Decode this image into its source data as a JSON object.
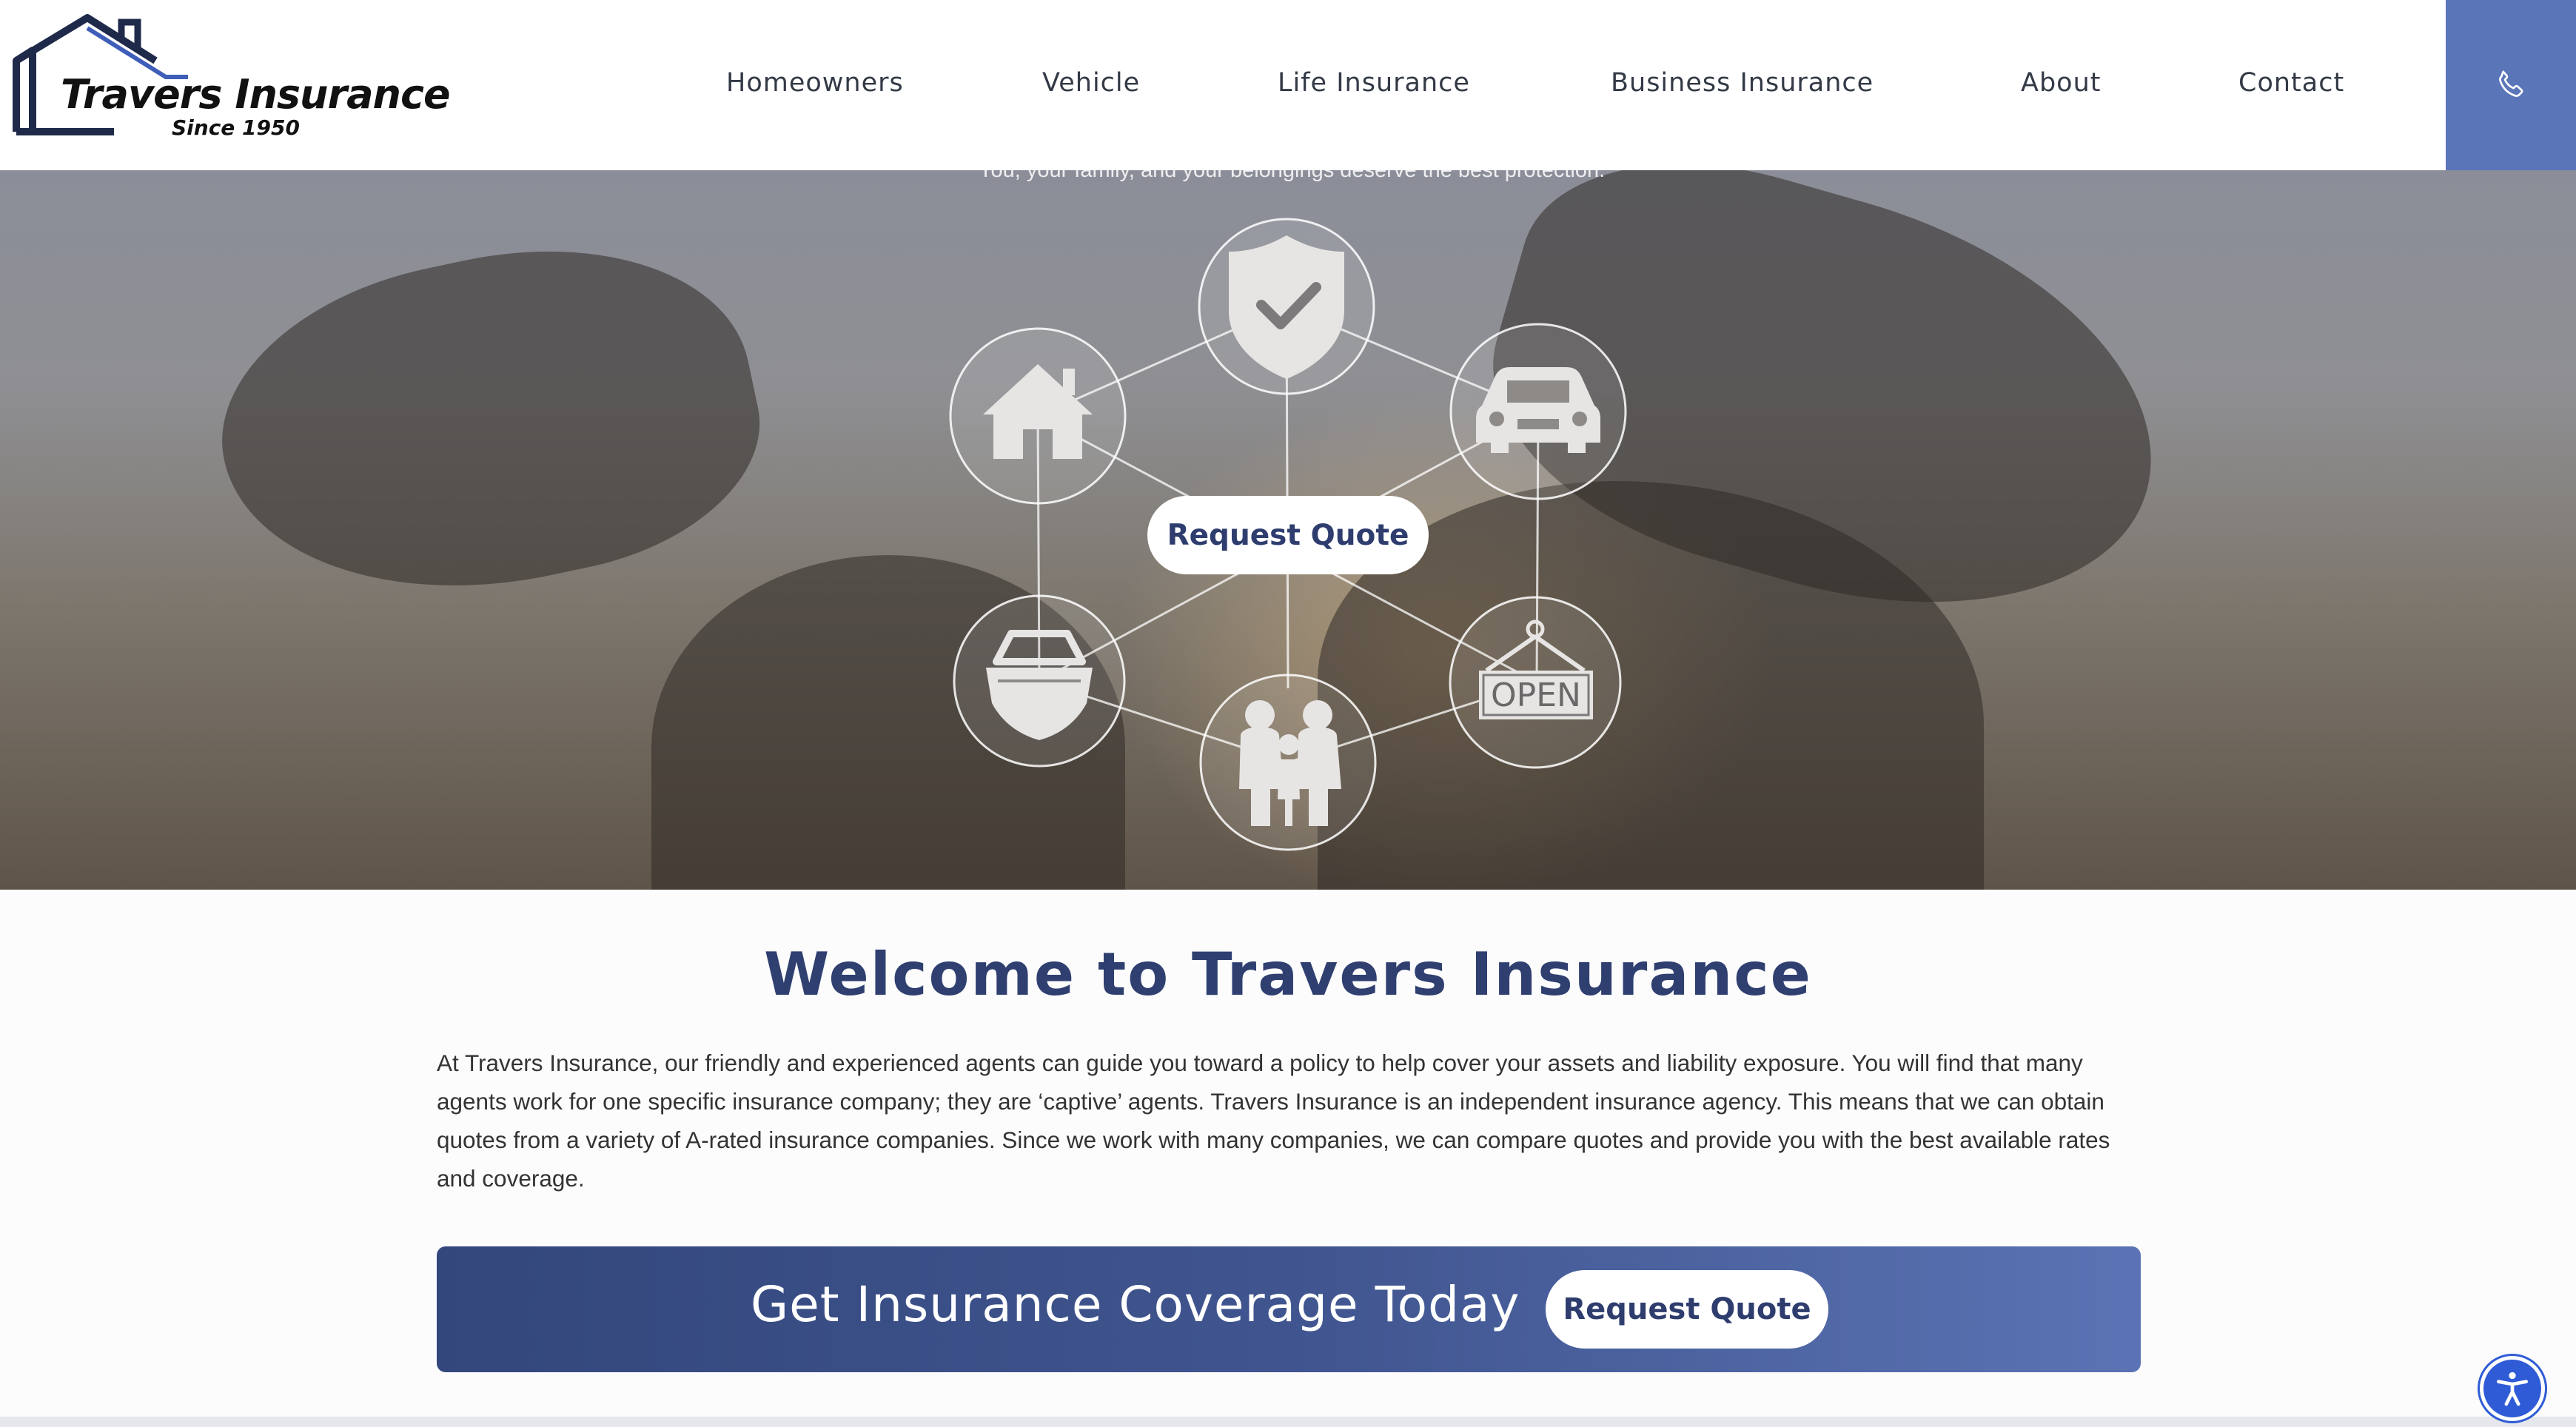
{
  "brand": {
    "name": "Travers Insurance",
    "tagline": "Since 1950"
  },
  "nav": {
    "items": [
      {
        "label": "Homeowners"
      },
      {
        "label": "Vehicle"
      },
      {
        "label": "Life Insurance"
      },
      {
        "label": "Business Insurance"
      },
      {
        "label": "About"
      },
      {
        "label": "Contact"
      }
    ],
    "phone_icon": "phone-icon"
  },
  "hero": {
    "tagline": "You, your family, and your belongings deserve the best protection.",
    "cta_label": "Request Quote",
    "icons": [
      "shield-check-icon",
      "home-icon",
      "car-icon",
      "boat-icon",
      "family-icon",
      "open-sign-icon"
    ],
    "open_sign_text": "OPEN"
  },
  "welcome": {
    "title": "Welcome to Travers Insurance",
    "body": "At Travers Insurance, our friendly and experienced agents can guide you toward a policy to help cover your assets and liability exposure. You will find that many agents work for one specific insurance company; they are ‘captive’ agents. Travers Insurance is an independent insurance agency. This means that we can obtain quotes from a variety of A-rated insurance companies. Since we work with many companies, we can compare quotes and provide you with the best available rates and coverage."
  },
  "cta": {
    "title": "Get Insurance Coverage Today",
    "button_label": "Request Quote"
  },
  "accessibility": {
    "icon": "accessibility-icon"
  },
  "colors": {
    "brand_blue": "#2f3f70",
    "accent_blue": "#5b75b9",
    "cta_gradient_start": "#33477c",
    "cta_gradient_end": "#5b73b4"
  }
}
